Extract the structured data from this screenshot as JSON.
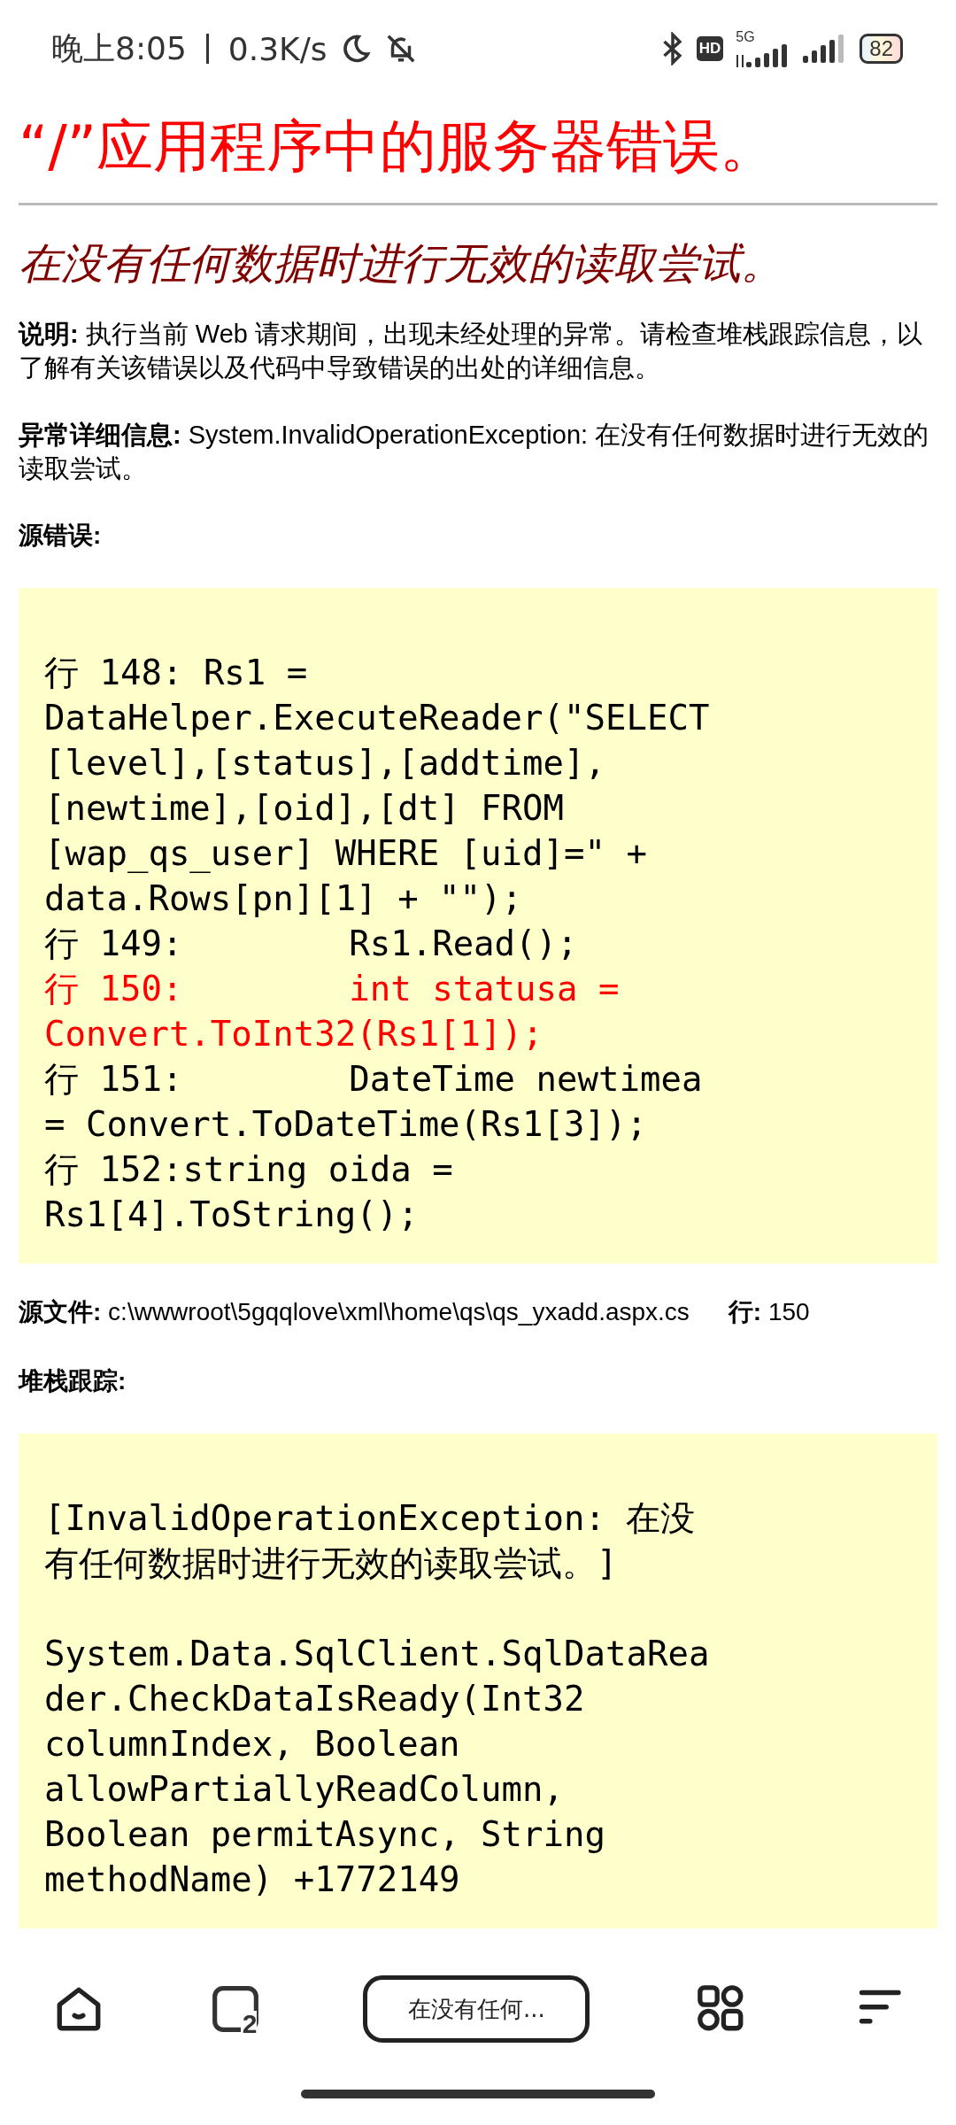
{
  "status_bar": {
    "time": "晚上8:05",
    "speed": "0.3K/s",
    "hd": "HD",
    "network": "5G",
    "battery": "82"
  },
  "page": {
    "title": "“/”应用程序中的服务器错误。",
    "subtitle": "在没有任何数据时进行无效的读取尝试。",
    "paragraphs": [
      "**说明:** 执行当前 Web 请求期间，出现未经处理的异常。请检查堆栈跟踪信息，以了解有关该错误以及代码中导致错误的出处的详细信息。",
      "**异常详细信息:** System.InvalidOperationException: 在没有任何数据时进行无效的读取尝试。"
    ],
    "source_heading": "源错误:",
    "source_lines": [
      {
        "text": "行 148: Rs1 = DataHelper.ExecuteReader(\"SELECT [level],[status],[addtime],[newtime],[oid],[dt] FROM [wap_qs_user] WHERE [uid]=\" + data.Rows[pn][1] + \"\");",
        "highlight": false
      },
      {
        "text": "行 149:        Rs1.Read();",
        "highlight": false
      },
      {
        "text": "行 150:        int statusa = Convert.ToInt32(Rs1[1]);",
        "highlight": true
      },
      {
        "text": "行 151:        DateTime newtimea = Convert.ToDateTime(Rs1[3]);",
        "highlight": false
      },
      {
        "text": "行 152:string oida = Rs1[4].ToString();",
        "highlight": false
      }
    ],
    "source_file_label": "源文件:",
    "source_file": "c:\\wwwroot\\5gqqlove\\xml\\home\\qs\\qs_yxadd.aspx.cs",
    "line_label": "行:",
    "line": "150",
    "stack_heading": "堆栈跟踪:",
    "stack_lines": [
      "[InvalidOperationException: 在没有任何数据时进行无效的读取尝试。]",
      "System.Data.SqlClient.SqlDataReader.CheckDataIsReady(Int32 columnIndex, Boolean allowPartiallyReadColumn, Boolean permitAsync, String methodName) +1772149"
    ]
  },
  "bottom_bar": {
    "tab_count": "2",
    "address": "在没有任何..."
  }
}
